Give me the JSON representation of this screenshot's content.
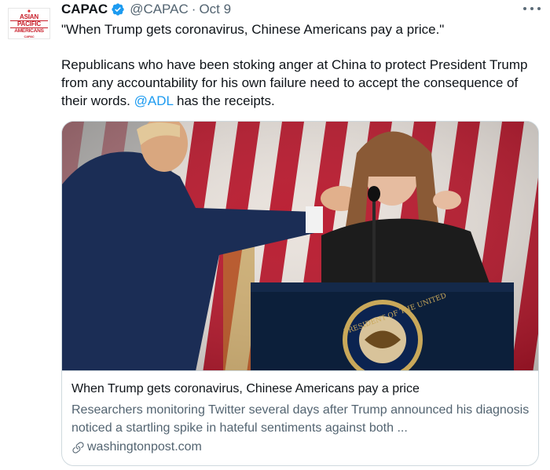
{
  "account": {
    "name": "CAPAC",
    "handle": "@CAPAC",
    "separator": "·",
    "date": "Oct 9",
    "avatar_lines": [
      "ASIAN",
      "PACIFIC",
      "AMERICANS",
      "CAPAC"
    ]
  },
  "tweet": {
    "line1": "\"When Trump gets coronavirus, Chinese Americans pay a price.\"",
    "line2_before": "Republicans who have been stoking anger at China to protect President Trump from any accountability for his own failure need to accept the consequence of their words. ",
    "mention": "@ADL",
    "line2_after": " has the receipts."
  },
  "card": {
    "title": "When Trump gets coronavirus, Chinese Americans pay a price",
    "description": "Researchers monitoring Twitter several days after Trump announced his diagnosis noticed a startling spike in hateful sentiments against both ...",
    "domain": "washingtonpost.com",
    "seal_text": "PRESIDENT OF THE UNITED"
  },
  "colors": {
    "link": "#1d9bf0",
    "secondary_text": "#536471",
    "verified": "#1d9bf0",
    "border": "#cfd9de",
    "avatar_red": "#c8202b"
  },
  "icons": {
    "verified": "verified-badge-icon",
    "more": "more-options-icon",
    "link": "link-icon"
  }
}
